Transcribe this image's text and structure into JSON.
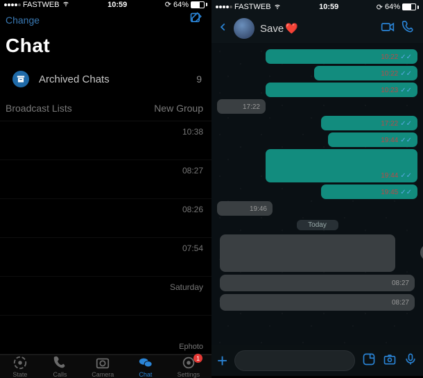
{
  "status": {
    "carrier": "FASTWEB",
    "time": "10:59",
    "battery_pct": "64%"
  },
  "left": {
    "edit_label": "Change",
    "title": "Chat",
    "archived_label": "Archived Chats",
    "archived_count": "9",
    "broadcast_label": "Broadcast Lists",
    "new_group_label": "New Group",
    "rows": [
      {
        "time": "10:38"
      },
      {
        "time": "08:27"
      },
      {
        "time": "08:26"
      },
      {
        "time": "07:54"
      },
      {
        "time": "Saturday"
      }
    ],
    "bottom_label": "Ephoto",
    "tabs": {
      "state": "State",
      "calls": "Calls",
      "camera": "Camera",
      "chat": "Chat",
      "settings": "Settings",
      "settings_badge": "1"
    }
  },
  "right": {
    "contact": "Save",
    "messages": {
      "m1_time": "10:22",
      "m2_time": "10:22",
      "m3_time": "10:23",
      "m4_time": "17:22",
      "m5_time": "17:22",
      "m6_time": "19:44",
      "m7_time": "19:44",
      "m8_time": "19:45",
      "m9_time": "19:46",
      "today_label": "Today",
      "g1_time": "08:27",
      "g2_time": "08:27"
    }
  }
}
